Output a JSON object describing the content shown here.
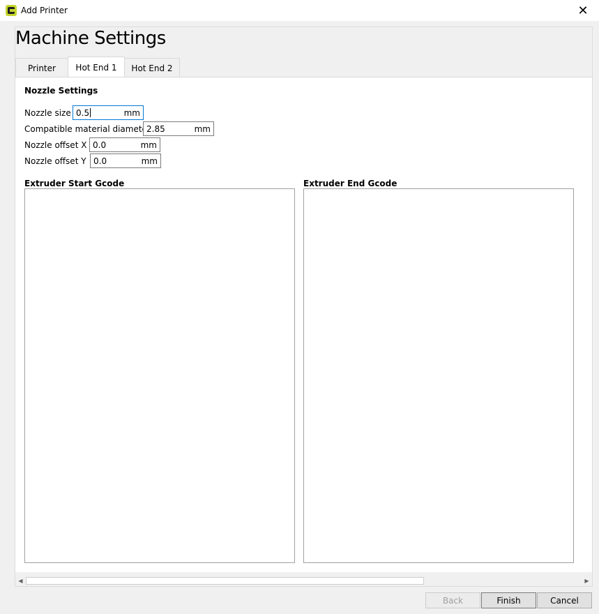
{
  "window": {
    "title": "Add Printer",
    "close_glyph": "✕"
  },
  "page": {
    "title": "Machine Settings"
  },
  "tabs": [
    {
      "label": "Printer",
      "active": false
    },
    {
      "label": "Hot End 1",
      "active": true
    },
    {
      "label": "Hot End 2",
      "active": false
    }
  ],
  "nozzle": {
    "section_title": "Nozzle Settings",
    "fields": [
      {
        "label": "Nozzle size",
        "value": "0.5",
        "unit": "mm"
      },
      {
        "label": "Compatible material diameter",
        "value": "2.85",
        "unit": "mm"
      },
      {
        "label": "Nozzle offset X",
        "value": "0.0",
        "unit": "mm"
      },
      {
        "label": "Nozzle offset Y",
        "value": "0.0",
        "unit": "mm"
      }
    ]
  },
  "gcode": {
    "start_title": "Extruder Start Gcode",
    "start_value": "",
    "end_title": "Extruder End Gcode",
    "end_value": ""
  },
  "scrollbar": {
    "left_arrow": "◀",
    "right_arrow": "▶"
  },
  "buttons": {
    "back": "Back",
    "finish": "Finish",
    "cancel": "Cancel"
  },
  "icons": {
    "app": "cura-logo-icon",
    "close": "close-icon",
    "scroll_left": "chevron-left-icon",
    "scroll_right": "chevron-right-icon"
  },
  "colors": {
    "accent": "#0078d7",
    "logo": "#c5d62e"
  }
}
